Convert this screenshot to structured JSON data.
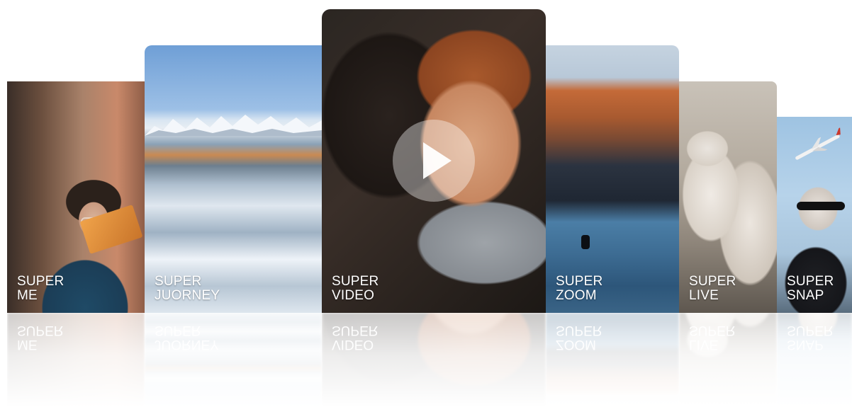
{
  "cards": [
    {
      "id": "me",
      "line1": "SUPER",
      "line2": "ME"
    },
    {
      "id": "journey",
      "line1": "SUPER",
      "line2": "JUORNEY"
    },
    {
      "id": "video",
      "line1": "SUPER",
      "line2": "VIDEO"
    },
    {
      "id": "zoom",
      "line1": "SUPER",
      "line2": "ZOOM"
    },
    {
      "id": "live",
      "line1": "SUPER",
      "line2": "LIVE"
    },
    {
      "id": "snap",
      "line1": "SUPER",
      "line2": "SNAP"
    }
  ],
  "play_icon": "play-icon",
  "colors": {
    "caption": "#ffffff",
    "background": "#ffffff"
  }
}
